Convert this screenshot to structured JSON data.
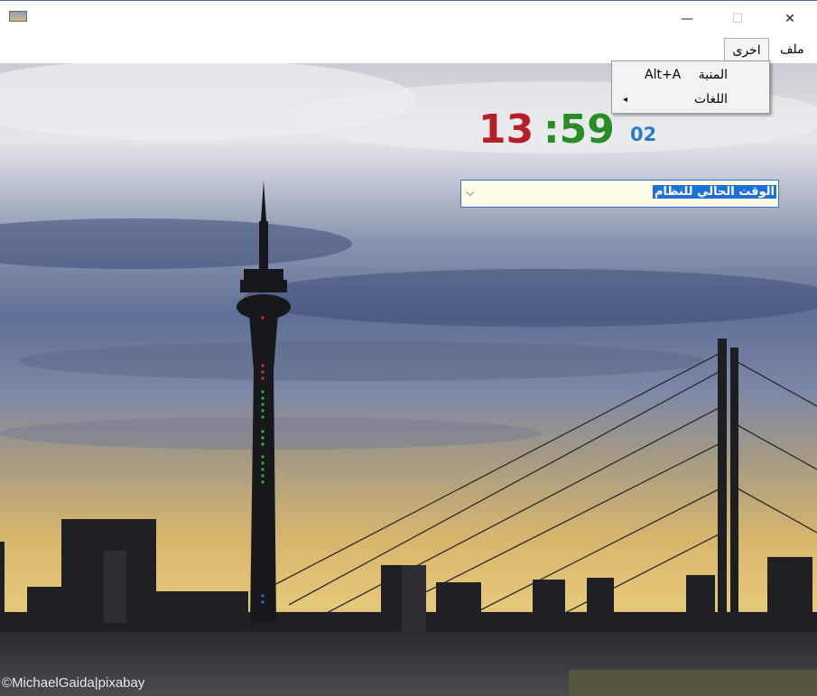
{
  "window": {
    "minimize_glyph": "—",
    "maximize_glyph": "☐",
    "close_glyph": "✕"
  },
  "menu": {
    "file_label": "ملف",
    "other_label": "اخرى"
  },
  "dropdown": {
    "items": [
      {
        "label": "المنبة",
        "shortcut": "Alt+A"
      },
      {
        "label": "اللغات",
        "arrow": "◂"
      }
    ]
  },
  "clock": {
    "hours": "13",
    "minutes": ":59",
    "seconds": "02",
    "colors": {
      "hours": "#b52024",
      "minutes": "#2a8c25",
      "seconds": "#2e79c5"
    }
  },
  "time_source": {
    "selected": "الوقت الحالي للنظام",
    "arrow_glyph": "⌵"
  },
  "background": {
    "credit": "©MichaelGaida|pixabay"
  }
}
